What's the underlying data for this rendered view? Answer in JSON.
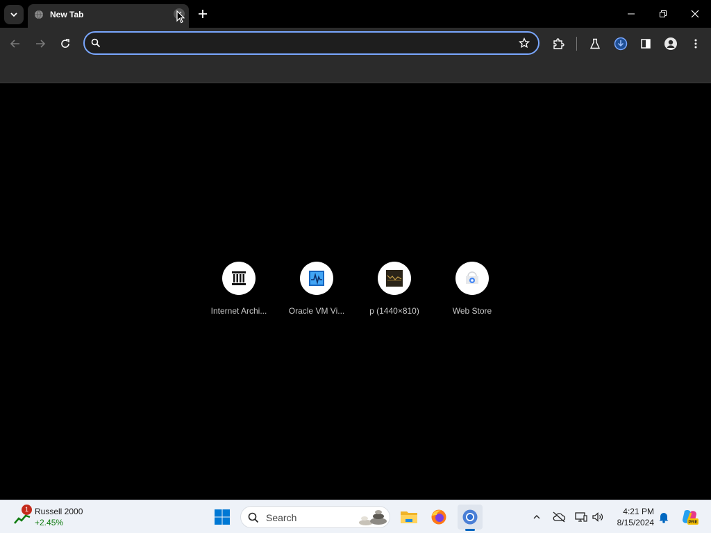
{
  "browser": {
    "tab_title": "New Tab",
    "omnibox_placeholder": "",
    "shortcuts": [
      {
        "label": "Internet Archi...",
        "icon": "internet-archive-icon"
      },
      {
        "label": "Oracle VM Vi...",
        "icon": "virtualbox-icon"
      },
      {
        "label": "p (1440×810)",
        "icon": "image-thumbnail-icon"
      },
      {
        "label": "Web Store",
        "icon": "web-store-icon"
      }
    ]
  },
  "taskbar": {
    "widget": {
      "badge": "1",
      "name": "Russell 2000",
      "change": "+2.45%"
    },
    "search_label": "Search",
    "clock": {
      "time": "4:21 PM",
      "date": "8/15/2024"
    }
  },
  "colors": {
    "accent": "#7aa7ff",
    "toolbar": "#2b2b2b",
    "taskbar": "#eef2f8",
    "positive": "#107c10"
  }
}
